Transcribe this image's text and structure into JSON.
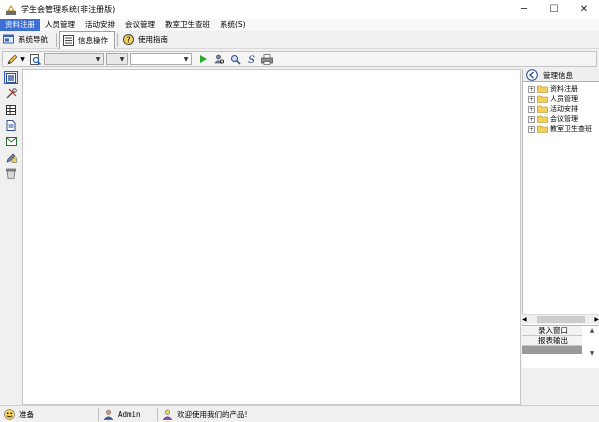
{
  "window": {
    "title": "学生会管理系统(非注册版)",
    "minimize_glyph": "─",
    "maximize_glyph": "☐",
    "close_glyph": "✕"
  },
  "menubar": {
    "items": [
      {
        "label": "资料注册",
        "active": true
      },
      {
        "label": "人员管理"
      },
      {
        "label": "活动安排"
      },
      {
        "label": "会议管理"
      },
      {
        "label": "教室卫生查班"
      },
      {
        "label": "系统(S)"
      }
    ]
  },
  "tabs": [
    {
      "label": "系统导航",
      "icon": "navigation-icon"
    },
    {
      "label": "信息操作",
      "icon": "info-operation-icon",
      "selected": true
    },
    {
      "label": "使用指南",
      "icon": "help-icon"
    }
  ],
  "toolbar": {
    "combo1_value": "",
    "combo2_value": "",
    "combo3_value": "",
    "icons": [
      "pencil-icon",
      "preview-icon",
      "play-icon",
      "find-user-icon",
      "search-icon",
      "s-letter-icon",
      "print-icon"
    ]
  },
  "leftbar": {
    "icons": [
      "form-icon",
      "tools-icon",
      "table-icon",
      "document-icon",
      "mail-icon",
      "edit-icon",
      "bin-icon"
    ]
  },
  "right_panel": {
    "title": "管理信息",
    "tree": [
      "资料注册",
      "人员管理",
      "活动安排",
      "会议管理",
      "教室卫生查班"
    ],
    "bottom_items": [
      "录入窗口",
      "报表输出"
    ]
  },
  "statusbar": {
    "status": "准备",
    "user": "Admin",
    "message": "欢迎使用我们的产品!"
  },
  "colors": {
    "menu_active": "#3b6fd1",
    "folder": "#f5d15c",
    "play": "#2aa82a"
  }
}
